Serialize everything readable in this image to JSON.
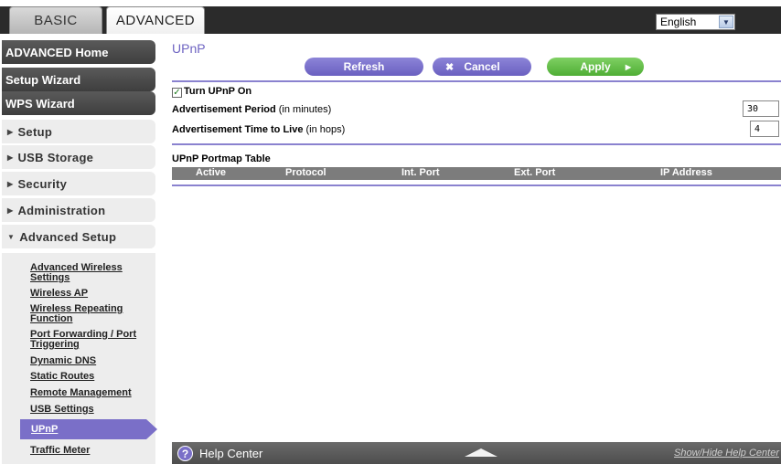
{
  "tabs": {
    "basic": "BASIC",
    "advanced": "ADVANCED"
  },
  "language": {
    "selected": "English"
  },
  "sidebar": {
    "advanced_home": "ADVANCED Home",
    "setup_wizard": "Setup Wizard",
    "wps_wizard": "WPS Wizard",
    "sections": [
      "Setup",
      "USB Storage",
      "Security",
      "Administration",
      "Advanced Setup"
    ],
    "sub_items": [
      "Advanced Wireless Settings",
      "Wireless AP",
      "Wireless Repeating Function",
      "Port Forwarding / Port Triggering",
      "Dynamic DNS",
      "Static Routes",
      "Remote Management",
      "USB Settings",
      "UPnP",
      "Traffic Meter"
    ],
    "active_item": "UPnP"
  },
  "main": {
    "title": "UPnP",
    "buttons": {
      "refresh": "Refresh",
      "cancel": "Cancel",
      "apply": "Apply"
    },
    "turn_on_label": "Turn UPnP On",
    "turn_on_checked": true,
    "adv_period_label": "Advertisement Period",
    "adv_period_unit": "(in minutes)",
    "adv_period_value": "30",
    "adv_ttl_label": "Advertisement Time to Live",
    "adv_ttl_unit": "(in hops)",
    "adv_ttl_value": "4",
    "table_title": "UPnP Portmap Table",
    "table_columns": [
      "Active",
      "Protocol",
      "Int. Port",
      "Ext. Port",
      "IP Address"
    ]
  },
  "help": {
    "title": "Help Center",
    "toggle_link": "Show/Hide Help Center"
  },
  "colors": {
    "accent": "#7a6fc8",
    "apply": "#5fbf43",
    "dark": "#2b2b2b"
  }
}
